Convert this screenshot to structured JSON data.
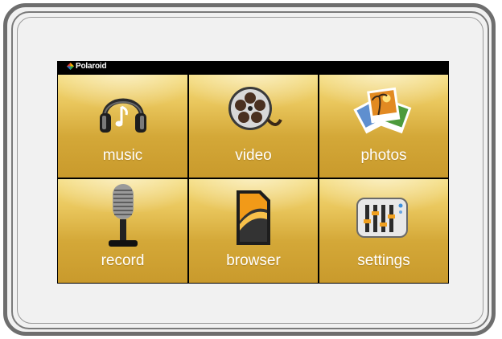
{
  "brand": {
    "name": "Polaroid"
  },
  "menu": {
    "items": [
      {
        "label": "music",
        "icon": "headphones-icon"
      },
      {
        "label": "video",
        "icon": "film-reel-icon"
      },
      {
        "label": "photos",
        "icon": "photos-icon"
      },
      {
        "label": "record",
        "icon": "microphone-icon"
      },
      {
        "label": "browser",
        "icon": "sd-card-icon"
      },
      {
        "label": "settings",
        "icon": "equalizer-icon"
      }
    ]
  },
  "colors": {
    "tile": "#e0b848",
    "screen": "#000000",
    "frame": "#6e6e6e",
    "label": "#ffffff"
  }
}
